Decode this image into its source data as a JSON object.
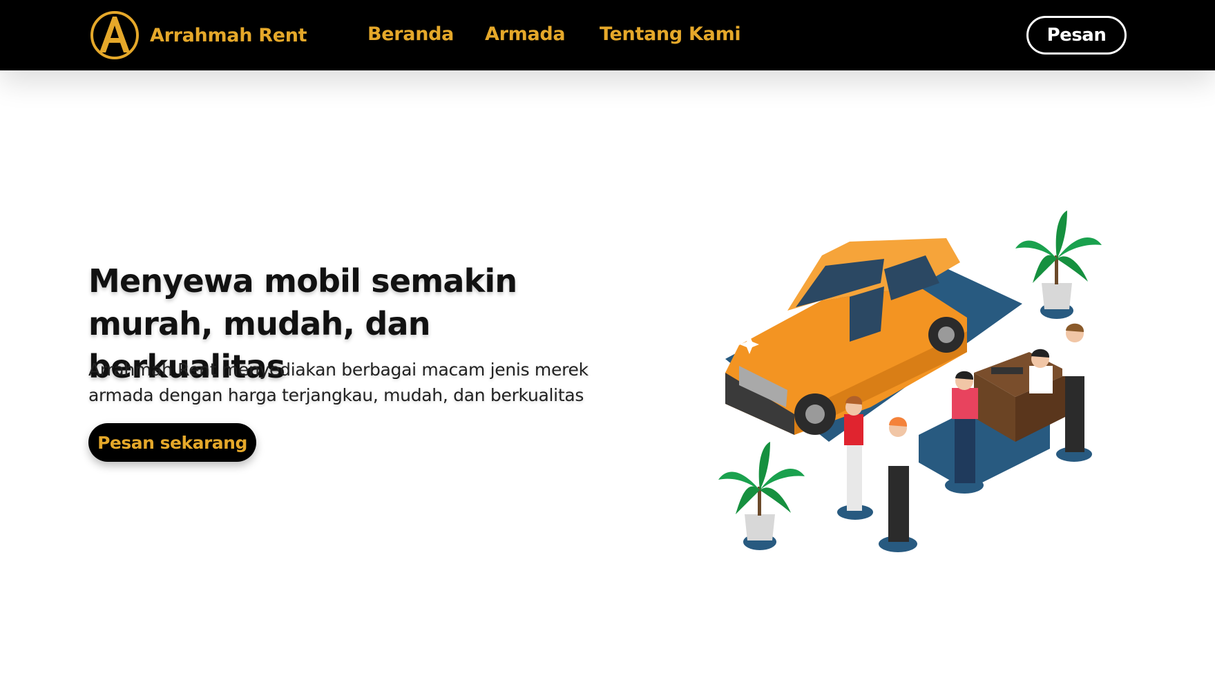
{
  "brand": {
    "name": "Arrahmah Rent",
    "logo_letter": "A",
    "logo_icon": "brand-logo-icon"
  },
  "nav": {
    "links": [
      {
        "label": "Beranda"
      },
      {
        "label": "Armada"
      },
      {
        "label": "Tentang Kami"
      }
    ],
    "cta_label": "Pesan"
  },
  "hero": {
    "title_line1": "Menyewa mobil semakin",
    "title_line2": "murah, mudah, dan berkualitas",
    "description_line1": "Arrahmah Rent menyediakan berbagai macam jenis merek",
    "description_line2": "armada dengan harga terjangkau, mudah, dan berkualitas",
    "cta_label": "Pesan sekarang"
  },
  "colors": {
    "accent": "#e5a82a",
    "navbar_bg": "#000000",
    "car": "#f39422",
    "base": "#285a80",
    "plant": "#1aa14e"
  }
}
